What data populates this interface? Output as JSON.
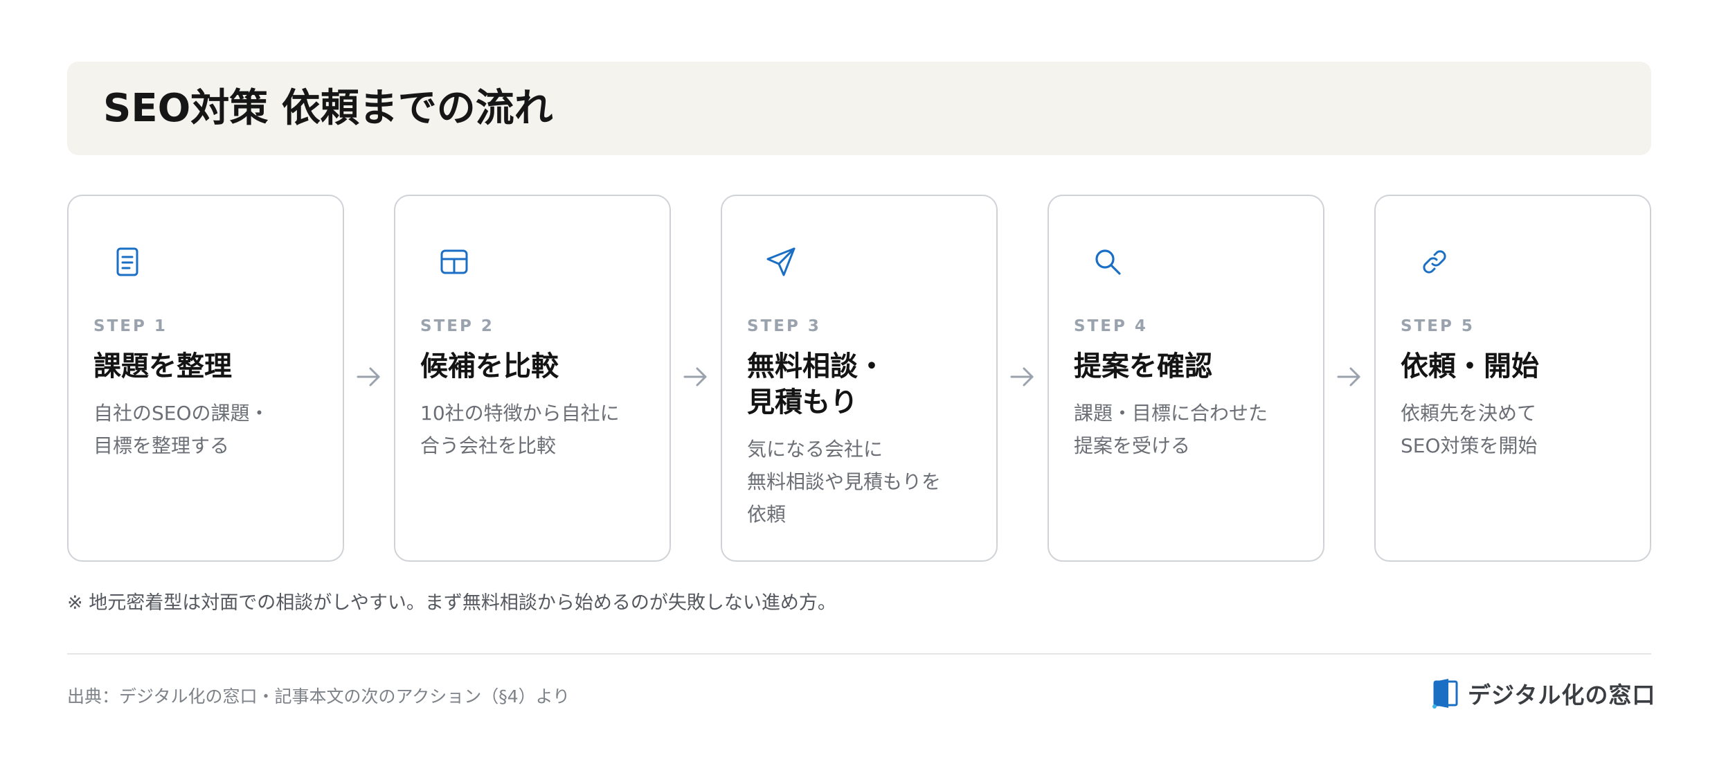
{
  "title": "SEO対策 依頼までの流れ",
  "steps": [
    {
      "icon": "document-icon",
      "label": "STEP 1",
      "title_lines": [
        "課題を整理"
      ],
      "desc_lines": [
        "自社のSEOの課題・",
        "目標を整理する"
      ]
    },
    {
      "icon": "table-icon",
      "label": "STEP 2",
      "title_lines": [
        "候補を比較"
      ],
      "desc_lines": [
        "10社の特徴から自社に",
        "合う会社を比較"
      ]
    },
    {
      "icon": "send-icon",
      "label": "STEP 3",
      "title_lines": [
        "無料相談・",
        "見積もり"
      ],
      "desc_lines": [
        "気になる会社に",
        "無料相談や見積もりを",
        "依頼"
      ]
    },
    {
      "icon": "search-icon",
      "label": "STEP 4",
      "title_lines": [
        "提案を確認"
      ],
      "desc_lines": [
        "課題・目標に合わせた",
        "提案を受ける"
      ]
    },
    {
      "icon": "link-icon",
      "label": "STEP 5",
      "title_lines": [
        "依頼・開始"
      ],
      "desc_lines": [
        "依頼先を決めて",
        "SEO対策を開始"
      ]
    }
  ],
  "note": "※ 地元密着型は対面での相談がしやすい。まず無料相談から始めるのが失敗しない進め方。",
  "source": "出典：デジタル化の窓口・記事本文の次のアクション（§4）より",
  "brand": {
    "name": "デジタル化の窓口"
  },
  "colors": {
    "accent": "#1a6fc4",
    "banner_bg": "#f5f3ee",
    "card_border": "#cfd2d6",
    "step_label": "#9aa3ad",
    "arrow": "#9aa3ad"
  }
}
